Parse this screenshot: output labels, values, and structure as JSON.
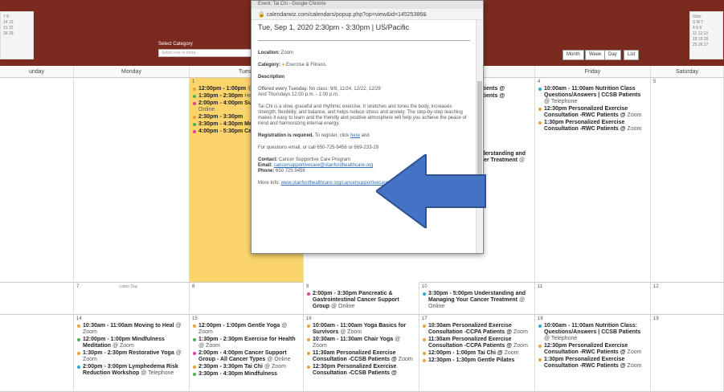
{
  "popup": {
    "window_title": "Event: Tai Chi - Google Chrome",
    "url": "calendarwiz.com/calendars/popup.php?op=view&id=14525386&",
    "when": "Tue, Sep 1, 2020 2:30pm - 3:30pm | US/Pacific",
    "location_label": "Location:",
    "location": "Zoom",
    "category_label": "Category:",
    "category": "Exercise & Fitness",
    "description_label": "Description",
    "offered": "Offered every Tuesday.",
    "no_class": "No class: 9/8, 11/24, 12/22, 12/29",
    "thursdays": "And Thursdays 12:00 p.m. - 1:00 p.m.",
    "desc_text": "Tai Chi is a slow, graceful and rhythmic exercise. It stretches and tones the body, increases strength, flexibility, and balance, and helps reduce stress and anxiety. The step-by-step teaching makes it easy to learn and the friendly and positive atmosphere will help you achieve the peace of mind and harmonizing internal energy.",
    "reg_bold": "Registration is required.",
    "reg_text": "To register, click",
    "reg_link": "here",
    "reg_tail": "and",
    "questions": "For questions email, or call 650-725-9456 or 669-233-29",
    "contact_label": "Contact:",
    "contact": "Cancer Supportive Care Program",
    "email_label": "Email:",
    "email": "cancersupportivecare@stanfordhealthcare.org",
    "phone_label": "Phone:",
    "phone": "650 725 9456",
    "more_label": "More Info:",
    "more_link": "www.stanfordhealthcare.org/cancersupportivecare"
  },
  "header": {
    "select_category_label": "Select Category",
    "select_placeholder": "Select one or more...",
    "view_buttons": [
      "Month",
      "Week",
      "Day",
      "List"
    ],
    "mini_left": [
      "7 8",
      "14 15",
      "21 22",
      "28 29"
    ],
    "mini_right": [
      "Octo",
      "S M T",
      "4 5 6",
      "11 12 13",
      "18 19 20",
      "25 26 27"
    ]
  },
  "calendar": {
    "days": [
      "unday",
      "Monday",
      "Tuesd",
      "day",
      "Friday",
      "Saturday"
    ],
    "weeks": [
      {
        "cells": [
          {
            "num": "",
            "events": []
          },
          {
            "num": "",
            "events": []
          },
          {
            "num": "1",
            "events": [
              {
                "t": "12:00pm - 1:00pm",
                "loc": "@ Zoom",
                "c": "#e8a33a"
              },
              {
                "t": "1:30pm - 2:30pm",
                "loc": "Health @ Zoom",
                "c": "#4caf50"
              },
              {
                "t": "2:00pm - 4:00pm Support Group -",
                "loc": "@ Online",
                "c": "#e040a0"
              },
              {
                "t": "2:30pm - 3:30pm",
                "loc": "",
                "c": "#e8a33a"
              },
              {
                "t": "3:30pm - 4:30pm Meditation",
                "loc": "@ Zoo",
                "c": "#4caf50"
              },
              {
                "t": "4:00pm - 5:30pm Cancer Support G",
                "loc": "",
                "c": "#e040a0"
              }
            ]
          },
          {
            "num": "",
            "events": [
              {
                "t": "lized Exercise PA Patients @",
                "loc": "",
                "c": ""
              },
              {
                "t": "lized Exercise PA Patients @",
                "loc": "",
                "c": ""
              },
              {
                "t": "n Tai Chi @",
                "loc": "",
                "c": ""
              },
              {
                "t": "Gentle Pilates",
                "loc": "",
                "c": ""
              },
              {
                "t": "utrition ers | CCPA",
                "loc": "",
                "c": ""
              },
              {
                "t": "d Exercise atients @",
                "loc": "",
                "c": ""
              },
              {
                "t": "Yoga Basics for",
                "loc": "",
                "c": ""
              },
              {
                "t": "Mindfulness",
                "loc": "",
                "c": ""
              },
              {
                "t": "Cancer t Group @",
                "loc": "",
                "c": ""
              },
              {
                "t": "3:30pm - 5:00pm Understanding and Managing Your Cancer Treatment",
                "loc": "@ Online",
                "c": "#2aa8d8"
              }
            ]
          },
          {
            "num": "4",
            "events": [
              {
                "t": "10:00am - 11:00am Nutrition Class Questions/Answers | CCSB Patients",
                "loc": "@ Telephone",
                "c": "#2aa8d8"
              },
              {
                "t": "12:30pm Personalized Exercise Consultation -RWC Patients @",
                "loc": "Zoom",
                "c": "#e8a33a"
              },
              {
                "t": "1:30pm Personalized Exercise Consultation -RWC Patients @",
                "loc": "Zoom",
                "c": "#e8a33a"
              }
            ]
          },
          {
            "num": "5",
            "events": []
          }
        ]
      },
      {
        "cells": [
          {
            "num": "",
            "events": []
          },
          {
            "num": "7",
            "holiday": "Labor Day",
            "events": []
          },
          {
            "num": "8",
            "events": []
          },
          {
            "num": "9",
            "events": [
              {
                "t": "2:00pm - 3:30pm Pancreatic & Gastrointestinal Cancer Support Group",
                "loc": "@ Online",
                "c": "#e040a0"
              }
            ]
          },
          {
            "num": "10",
            "events": [
              {
                "t": "3:30pm - 5:00pm Understanding and Managing Your Cancer Treatment",
                "loc": "@ Online",
                "c": "#2aa8d8"
              }
            ]
          },
          {
            "num": "11",
            "events": []
          },
          {
            "num": "12",
            "events": []
          }
        ]
      },
      {
        "cells": [
          {
            "num": "",
            "events": []
          },
          {
            "num": "14",
            "events": [
              {
                "t": "10:30am - 11:00am Moving to Heal",
                "loc": "@ Zoom",
                "c": "#e8a33a"
              },
              {
                "t": "12:00pm - 1:00pm Mindfulness Meditation",
                "loc": "@ Zoom",
                "c": "#4caf50"
              },
              {
                "t": "1:30pm - 2:30pm Restorative Yoga",
                "loc": "@ Zoom",
                "c": "#e8a33a"
              },
              {
                "t": "2:00pm - 3:00pm Lymphedema Risk Reduction Workshop",
                "loc": "@ Telephone",
                "c": "#2aa8d8"
              }
            ]
          },
          {
            "num": "15",
            "events": [
              {
                "t": "12:00pm - 1:00pm Gentle Yoga",
                "loc": "@ Zoom",
                "c": "#e8a33a"
              },
              {
                "t": "1:30pm - 2:30pm Exercise for Health",
                "loc": "@ Zoom",
                "c": "#4caf50"
              },
              {
                "t": "2:00pm - 4:00pm Cancer Support Group - All Cancer Types",
                "loc": "@ Online",
                "c": "#e040a0"
              },
              {
                "t": "2:30pm - 3:30pm Tai Chi",
                "loc": "@ Zoom",
                "c": "#e8a33a"
              },
              {
                "t": "3:30pm - 4:30pm Mindfulness",
                "loc": "",
                "c": "#4caf50"
              }
            ]
          },
          {
            "num": "16",
            "events": [
              {
                "t": "10:00am - 11:00am Yoga Basics for Survivors",
                "loc": "@ Zoom",
                "c": "#e8a33a"
              },
              {
                "t": "10:30am - 11:30am Chair Yoga",
                "loc": "@ Zoom",
                "c": "#e8a33a"
              },
              {
                "t": "11:30am Personalized Exercise Consultation -CCSB Patients @",
                "loc": "Zoom",
                "c": "#e8a33a"
              },
              {
                "t": "12:30pm Personalized Exercise Consultation -CCSB Patients @",
                "loc": "",
                "c": "#e8a33a"
              }
            ]
          },
          {
            "num": "17",
            "events": [
              {
                "t": "10:30am Personalized Exercise Consultation -CCPA Patients @",
                "loc": "Zoom",
                "c": "#e8a33a"
              },
              {
                "t": "11:30am Personalized Exercise Consultation -CCPA Patients @",
                "loc": "Zoom",
                "c": "#e8a33a"
              },
              {
                "t": "12:00pm - 1:00pm Tai Chi @",
                "loc": "Zoom",
                "c": "#e8a33a"
              },
              {
                "t": "12:30pm - 1:30pm Gentle Pilates",
                "loc": "",
                "c": "#e8a33a"
              }
            ]
          },
          {
            "num": "18",
            "events": [
              {
                "t": "10:00am - 11:00am Nutrition Class: Questions/Answers | CCSB Patients",
                "loc": "@ Telephone",
                "c": "#2aa8d8"
              },
              {
                "t": "12:30pm Personalized Exercise Consultation -RWC Patients @",
                "loc": "Zoom",
                "c": "#e8a33a"
              },
              {
                "t": "1:30pm Personalized Exercise Consultation -RWC Patients @",
                "loc": "Zoom",
                "c": "#e8a33a"
              }
            ]
          },
          {
            "num": "19",
            "events": []
          }
        ]
      }
    ]
  }
}
